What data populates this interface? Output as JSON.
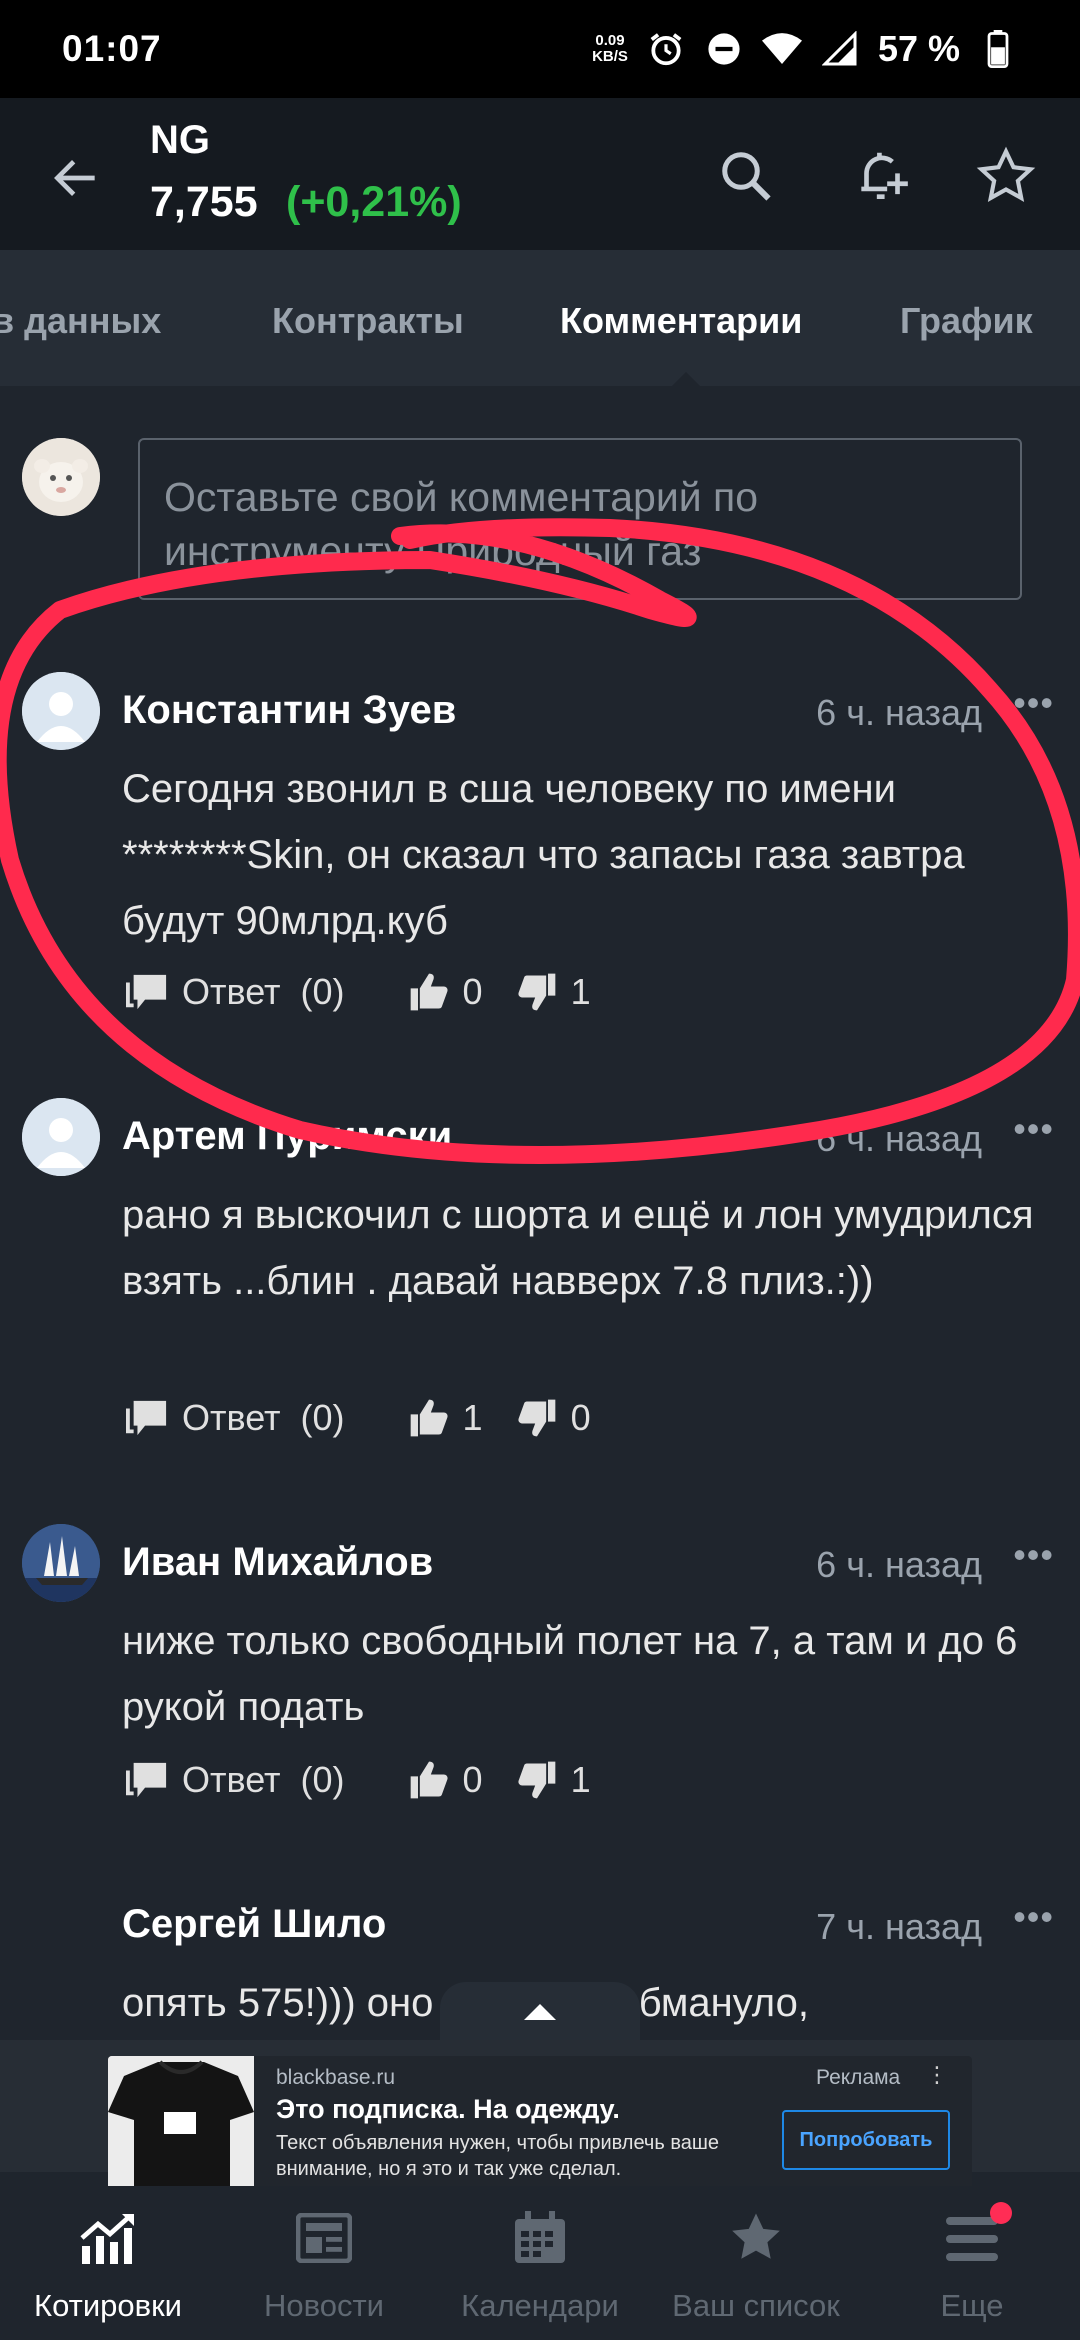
{
  "status_bar": {
    "time": "01:07",
    "net_speed_value": "0.09",
    "net_speed_unit": "KB/S",
    "battery": "57 %"
  },
  "header": {
    "symbol": "NG",
    "price": "7,755",
    "change": "(+0,21%)",
    "colors": {
      "positive": "#2fc04a",
      "background": "#151a20"
    }
  },
  "tabs": {
    "items": [
      {
        "label": "Обзор данных"
      },
      {
        "label": "Контракты"
      },
      {
        "label": "Комментарии"
      },
      {
        "label": "График"
      }
    ],
    "active": "Комментарии",
    "first_visible_fragment": "в данных"
  },
  "comment_input": {
    "placeholder": "Оставьте свой комментарий по инструменту Природный газ"
  },
  "comments": [
    {
      "author": "Константин Зуев",
      "time": "6 ч. назад",
      "text": "Сегодня звонил в сша человеку по имени ********Skin, он сказал что запасы газа завтра будут 90млрд.куб",
      "reply_label": "Ответ",
      "reply_count": "(0)",
      "likes": "0",
      "dislikes": "1",
      "avatar": "default-avatar"
    },
    {
      "author": "Артем Пуримски",
      "time": "6 ч. назад",
      "text": "рано я выскочил с шорта и ещё и лон умудрился взять ...блин . давай навверх 7.8 плиз.:))",
      "reply_label": "Ответ",
      "reply_count": "(0)",
      "likes": "1",
      "dislikes": "0",
      "avatar": "default-avatar"
    },
    {
      "author": "Иван Михайлов",
      "time": "6 ч. назад",
      "text": "ниже только свободный полет на 7, а там и до 6 рукой подать",
      "reply_label": "Ответ",
      "reply_count": "(0)",
      "likes": "0",
      "dislikes": "1",
      "avatar": "sailing-ship-avatar"
    },
    {
      "author": "Сергей Шило",
      "time": "7 ч. назад",
      "text": "опять 575!))) оно намедни обмануло,",
      "avatar": "none"
    }
  ],
  "ad": {
    "domain": "blackbase.ru",
    "label": "Реклама",
    "title": "Это подписка. На одежду.",
    "body": "Текст объявления нужен, чтобы привлечь ваше внимание, но я это и так уже сделал.",
    "cta": "Попробовать",
    "image": "black-tshirt-product-image"
  },
  "bottom_nav": {
    "items": [
      {
        "label": "Котировки",
        "icon": "quotes-chart-icon"
      },
      {
        "label": "Новости",
        "icon": "newspaper-icon"
      },
      {
        "label": "Календари",
        "icon": "calendar-icon"
      },
      {
        "label": "Ваш список",
        "icon": "star-icon"
      },
      {
        "label": "Еще",
        "icon": "menu-icon"
      }
    ],
    "active": "Котировки",
    "accent": "#ff2d55"
  }
}
